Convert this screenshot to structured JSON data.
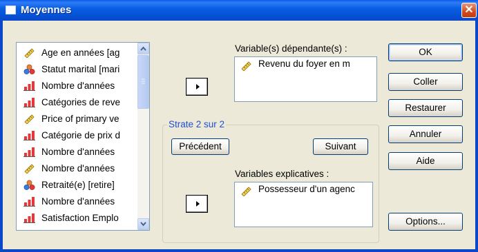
{
  "window": {
    "title": "Moyennes",
    "close_glyph": "✕"
  },
  "source_list": {
    "items": [
      {
        "label": "Age en années [ag",
        "icon": "ruler-icon"
      },
      {
        "label": "Statut marital [mari",
        "icon": "nominal-icon"
      },
      {
        "label": "Nombre d'années",
        "icon": "ordinal-icon"
      },
      {
        "label": "Catégories de reve",
        "icon": "ordinal-icon"
      },
      {
        "label": "Price of primary ve",
        "icon": "ruler-icon"
      },
      {
        "label": "Catégorie de prix d",
        "icon": "ordinal-icon"
      },
      {
        "label": "Nombre d'années",
        "icon": "ordinal-icon"
      },
      {
        "label": "Nombre d'années",
        "icon": "ruler-icon"
      },
      {
        "label": "Retraité(e) [retire]",
        "icon": "nominal-icon"
      },
      {
        "label": "Nombre d'années",
        "icon": "ordinal-icon"
      },
      {
        "label": "Satisfaction Emplo",
        "icon": "ordinal-icon"
      }
    ]
  },
  "dependent": {
    "label": "Variable(s) dépendante(s) :",
    "items": [
      {
        "label": "Revenu du foyer en m",
        "icon": "ruler-icon"
      }
    ]
  },
  "layer": {
    "title": "Strate 2 sur 2",
    "prev_label": "Précédent",
    "next_label": "Suivant",
    "independent_label": "Variables explicatives :",
    "items": [
      {
        "label": "Possesseur d'un agenc",
        "icon": "ruler-icon"
      }
    ]
  },
  "buttons": {
    "ok": "OK",
    "paste": "Coller",
    "reset": "Restaurer",
    "cancel": "Annuler",
    "help": "Aide",
    "options": "Options..."
  },
  "colors": {
    "title_bar": "#0a5fe3",
    "dialog_bg": "#ece9d8",
    "group_title": "#1e4fd2"
  }
}
